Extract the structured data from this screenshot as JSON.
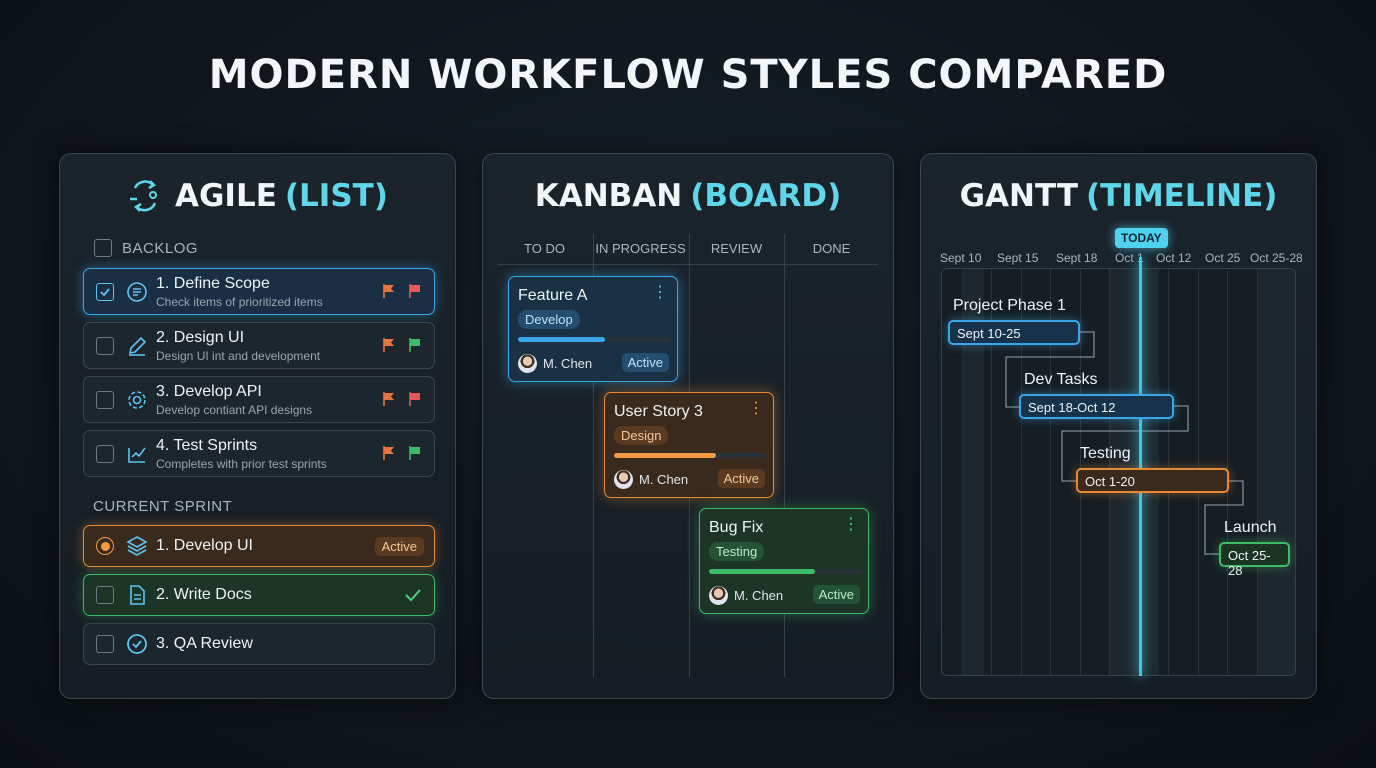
{
  "title": "MODERN WORKFLOW STYLES COMPARED",
  "agile": {
    "title_main": "AGILE",
    "title_accent": "(LIST)",
    "icon": "cycle-arrows-icon",
    "backlog_label": "BACKLOG",
    "backlog": [
      {
        "name": "1. Define Scope",
        "sub": "Check items of prioritized items",
        "checked": true,
        "icon": "list-icon",
        "flag1": "#e3763f",
        "flag2": "#e35a5a"
      },
      {
        "name": "2. Design UI",
        "sub": "Design UI int and development",
        "checked": false,
        "icon": "pencil-icon",
        "flag1": "#e3763f",
        "flag2": "#3dbb68"
      },
      {
        "name": "3. Develop API",
        "sub": "Develop contiant API designs",
        "checked": false,
        "icon": "gear-icon",
        "flag1": "#e3763f",
        "flag2": "#e35a5a"
      },
      {
        "name": "4. Test Sprints",
        "sub": "Completes with prior test sprints",
        "checked": false,
        "icon": "chart-check-icon",
        "flag1": "#e3763f",
        "flag2": "#3dbb68"
      }
    ],
    "sprint_label": "CURRENT SPRINT",
    "sprint": [
      {
        "name": "1. Develop UI",
        "status": "Active",
        "icon": "layers-icon"
      },
      {
        "name": "2. Write Docs",
        "icon": "document-icon"
      },
      {
        "name": "3. QA Review",
        "icon": "check-circle-icon"
      }
    ]
  },
  "kanban": {
    "title_main": "KANBAN",
    "title_accent": "(BOARD)",
    "columns": [
      "TO DO",
      "IN PROGRESS",
      "REVIEW",
      "DONE"
    ],
    "cards": [
      {
        "name": "Feature A",
        "tag": "Develop",
        "progress": 0.57,
        "user": "M. Chen",
        "status": "Active",
        "color": "#3aa6e8"
      },
      {
        "name": "User Story 3",
        "tag": "Design",
        "progress": 0.67,
        "user": "M. Chen",
        "status": "Active",
        "color": "#e38a36"
      },
      {
        "name": "Bug Fix",
        "tag": "Testing",
        "progress": 0.7,
        "user": "M. Chen",
        "status": "Active",
        "color": "#3dbb68"
      }
    ]
  },
  "gantt": {
    "title_main": "GANTT",
    "title_accent": "(TIMELINE)",
    "dates": [
      "Sept 10",
      "Sept 15",
      "Sept 18",
      "Oct 1",
      "Oct 12",
      "Oct 25",
      "Oct 25-28"
    ],
    "today_label": "TODAY",
    "tasks": [
      {
        "name": "Project Phase 1",
        "range": "Sept 10-25",
        "color": "#3aa6e8"
      },
      {
        "name": "Dev Tasks",
        "range": "Sept 18-Oct 12",
        "color": "#3aa6e8"
      },
      {
        "name": "Testing",
        "range": "Oct 1-20",
        "color": "#e38a36"
      },
      {
        "name": "Launch",
        "range": "Oct 25-28",
        "color": "#3dbb68"
      }
    ]
  }
}
